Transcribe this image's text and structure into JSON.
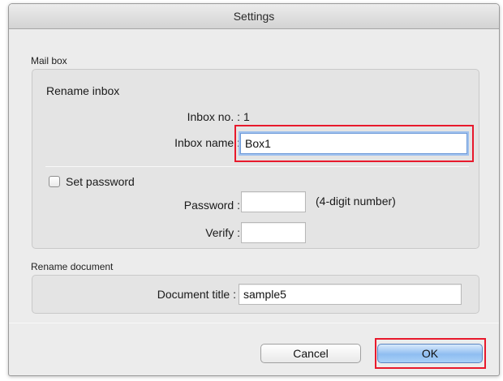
{
  "window": {
    "title": "Settings"
  },
  "mailbox": {
    "group_label": "Mail box",
    "rename_heading": "Rename inbox",
    "inbox_no_label": "Inbox no. :",
    "inbox_no_value": "1",
    "inbox_name_label": "Inbox name :",
    "inbox_name_value": "Box1",
    "set_password_label": "Set password",
    "set_password_checked": false,
    "password_label": "Password :",
    "password_value": "",
    "password_hint": "(4-digit number)",
    "verify_label": "Verify :",
    "verify_value": ""
  },
  "document": {
    "group_label": "Rename document",
    "title_label": "Document title :",
    "title_value": "sample5"
  },
  "buttons": {
    "cancel": "Cancel",
    "ok": "OK"
  },
  "colors": {
    "highlight": "#e8192c",
    "focus_ring": "#9fc1ee",
    "ok_button": "#8fbdf1"
  }
}
